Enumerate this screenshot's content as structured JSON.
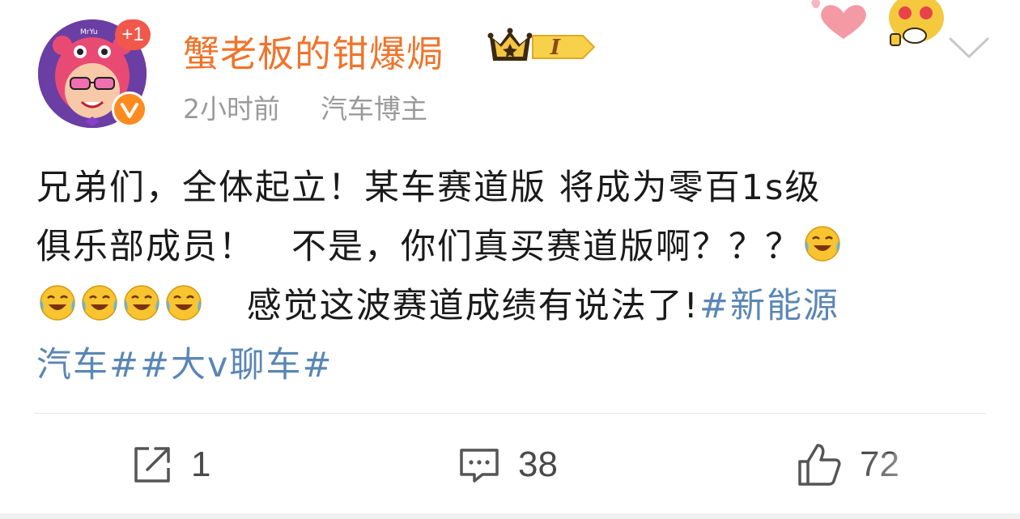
{
  "post": {
    "author": {
      "name": "蟹老板的钳爆焗",
      "follow_badge": "+1",
      "vip_level": "I",
      "avatar_sticker_text": "MrYu"
    },
    "meta": {
      "time": "2小时前",
      "tag": "汽车博主"
    },
    "content": {
      "line1": "兄弟们，全体起立！某车赛道版 将成为零百1s级",
      "line2": "俱乐部成员！　不是，你们真买赛道版啊？？？",
      "line3": "感觉这波赛道成绩有说法了!",
      "hashtag1_part1": "#新能源",
      "hashtag1_part2": "汽车#",
      "hashtag2": "#大v聊车#",
      "emoji_name": "laughing-tears-icon"
    },
    "actions": {
      "repost_count": "1",
      "comment_count": "38",
      "like_count": "72"
    },
    "colors": {
      "username": "#f0732a",
      "hashtag": "#5a86b5",
      "meta": "#9a9a9a"
    }
  }
}
